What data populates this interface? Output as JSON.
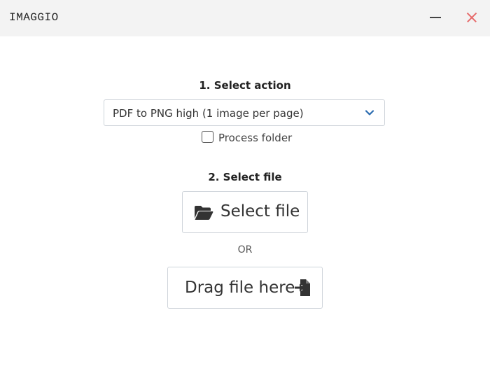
{
  "window": {
    "title": "IMAGGIO",
    "minimize_icon": "minimize-icon",
    "close_icon": "close-icon",
    "close_color": "#e66a6a"
  },
  "step1": {
    "title": "1. Select action",
    "select_value": "PDF to PNG high (1 image per page)",
    "select_icon": "chevron-down-icon",
    "accent_color": "#2b6cb0",
    "checkbox_label": "Process folder",
    "checkbox_checked": false
  },
  "step2": {
    "title": "2. Select file",
    "select_file_label": "Select file",
    "select_file_icon": "folder-open-icon",
    "or_text": "OR",
    "drag_label": "Drag file here",
    "drag_icon": "file-import-icon"
  }
}
